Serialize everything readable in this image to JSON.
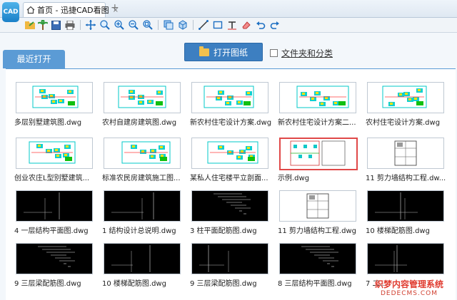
{
  "app": {
    "logo_text": "CAD",
    "tab_label": "首页 - 迅捷CAD看图",
    "tab_close": "×",
    "add_tab": "+"
  },
  "toolbar": {
    "icons": [
      "open-folder-icon",
      "palm-tree-icon",
      "save-icon",
      "print-icon",
      "pan-icon",
      "zoom-window-icon",
      "zoom-in-icon",
      "zoom-out-icon",
      "zoom-extents-icon",
      "layers-icon",
      "3d-view-icon",
      "measure-line-icon",
      "rectangle-icon",
      "text-icon",
      "eraser-icon",
      "undo-icon",
      "redo-icon"
    ]
  },
  "recent": {
    "tab_label": "最近打开"
  },
  "open_button": {
    "label": "打开图纸"
  },
  "folder_option": {
    "label": "文件夹和分类"
  },
  "files": [
    {
      "name": "多层别墅建筑图.dwg",
      "style": "color"
    },
    {
      "name": "农村自建房建筑图.dwg",
      "style": "color"
    },
    {
      "name": "新农村住宅设计方案.dwg",
      "style": "color"
    },
    {
      "name": "新农村住宅设计方案二...",
      "style": "color"
    },
    {
      "name": "农村住宅设计方案.dwg",
      "style": "color"
    },
    {
      "name": "创业农庄L型别墅建筑...",
      "style": "color"
    },
    {
      "name": "标准农民房建筑施工图...",
      "style": "color"
    },
    {
      "name": "某私人住宅楼平立剖面...",
      "style": "color"
    },
    {
      "name": "示例.dwg",
      "style": "selected"
    },
    {
      "name": "11 剪力墙结构工程.dw...",
      "style": "plan"
    },
    {
      "name": "4 一层结构平面图.dwg",
      "style": "dark"
    },
    {
      "name": "1 结构设计总说明.dwg",
      "style": "dark"
    },
    {
      "name": "3 柱平面配筋图.dwg",
      "style": "dark"
    },
    {
      "name": "11 剪力墙结构工程.dwg",
      "style": "plan"
    },
    {
      "name": "10 楼梯配筋图.dwg",
      "style": "dark"
    },
    {
      "name": "9 三层梁配筋图.dwg",
      "style": "dark"
    },
    {
      "name": "10 楼梯配筋图.dwg",
      "style": "dark"
    },
    {
      "name": "9 三层梁配筋图.dwg",
      "style": "dark"
    },
    {
      "name": "8 三层结构平面图.dwg",
      "style": "dark"
    },
    {
      "name": "7 二...",
      "style": "dark"
    }
  ],
  "watermark": {
    "line1": "织梦内容管理系统",
    "line2": "DEDECMS.COM"
  }
}
